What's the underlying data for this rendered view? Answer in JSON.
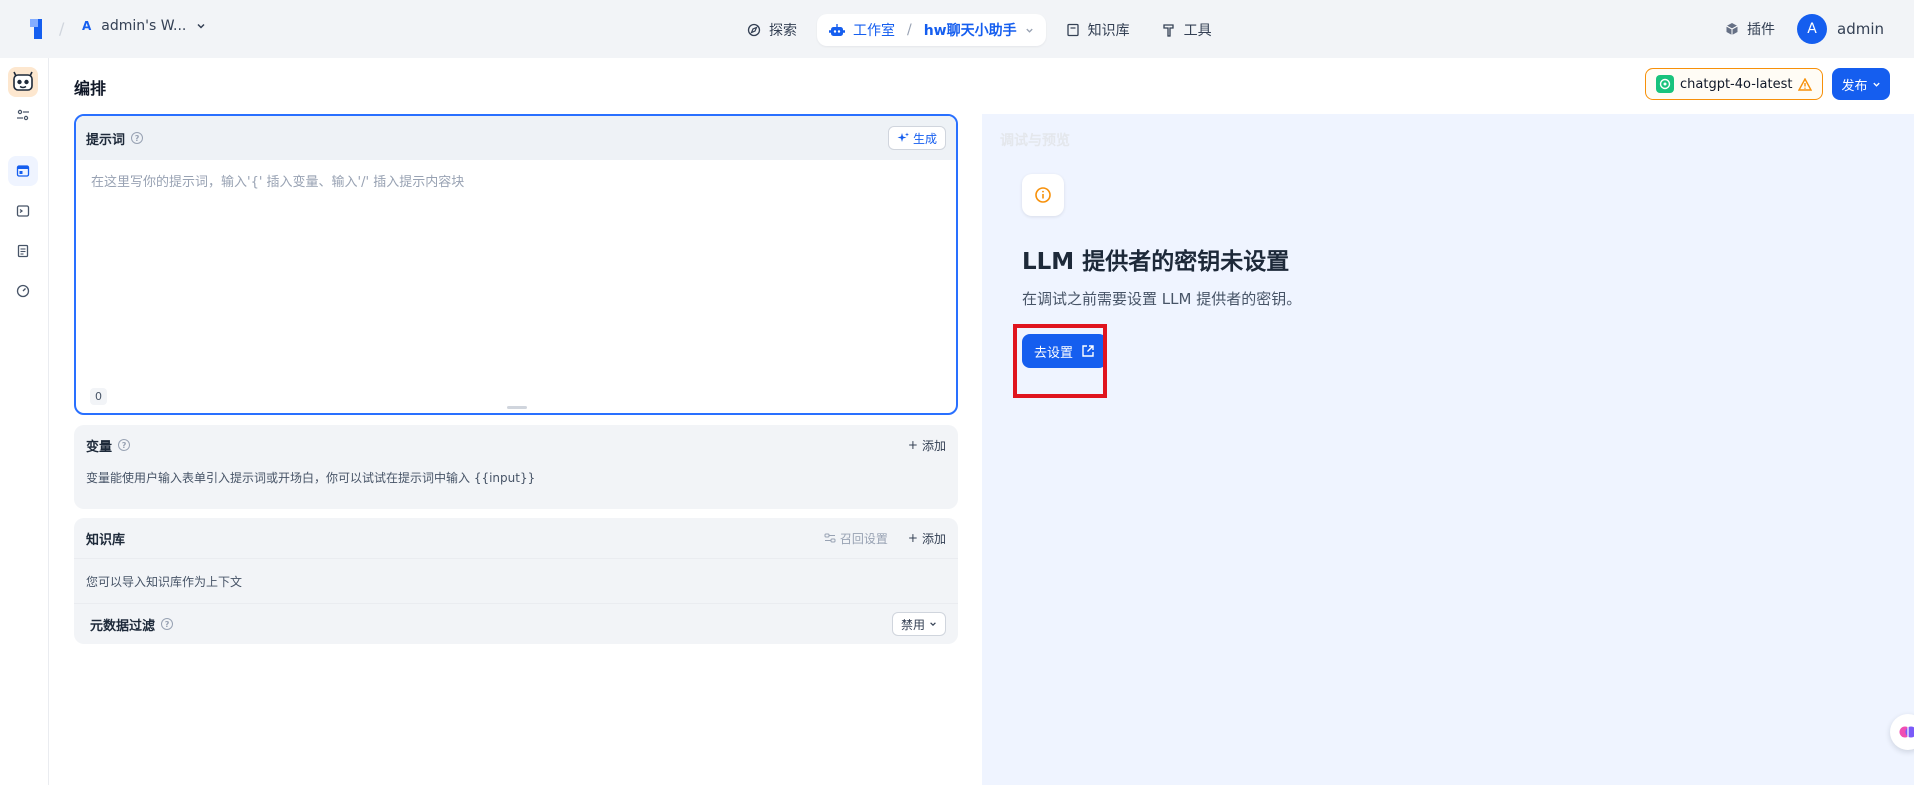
{
  "topbar": {
    "workspace_avatar": "A",
    "workspace_name": "admin's W...",
    "nav": {
      "explore": "探索",
      "studio": "工作室",
      "app_name": "hw聊天小助手",
      "knowledge": "知识库",
      "tools": "工具"
    },
    "plugins": "插件",
    "user_avatar": "A",
    "user_name": "admin"
  },
  "main": {
    "title": "编排",
    "model_name": "chatgpt-4o-latest",
    "publish_label": "发布"
  },
  "prompt": {
    "label": "提示词",
    "generate_label": "生成",
    "placeholder": "在这里写你的提示词，输入'{' 插入变量、输入'/' 插入提示内容块",
    "count": "0"
  },
  "variables": {
    "title": "变量",
    "add_label": "添加",
    "description": "变量能使用户输入表单引入提示词或开场白，你可以试试在提示词中输入 {{input}}"
  },
  "knowledge": {
    "title": "知识库",
    "recall_label": "召回设置",
    "add_label": "添加",
    "description": "您可以导入知识库作为上下文",
    "metadata_filter_label": "元数据过滤",
    "metadata_filter_value": "禁用"
  },
  "debug": {
    "ghost_title": "调试与预览",
    "warning_title": "LLM 提供者的密钥未设置",
    "warning_desc": "在调试之前需要设置 LLM 提供者的密钥。",
    "go_settings_label": "去设置"
  },
  "colors": {
    "accent": "#155eef",
    "warning": "#f79009",
    "highlight": "#e0141e"
  }
}
